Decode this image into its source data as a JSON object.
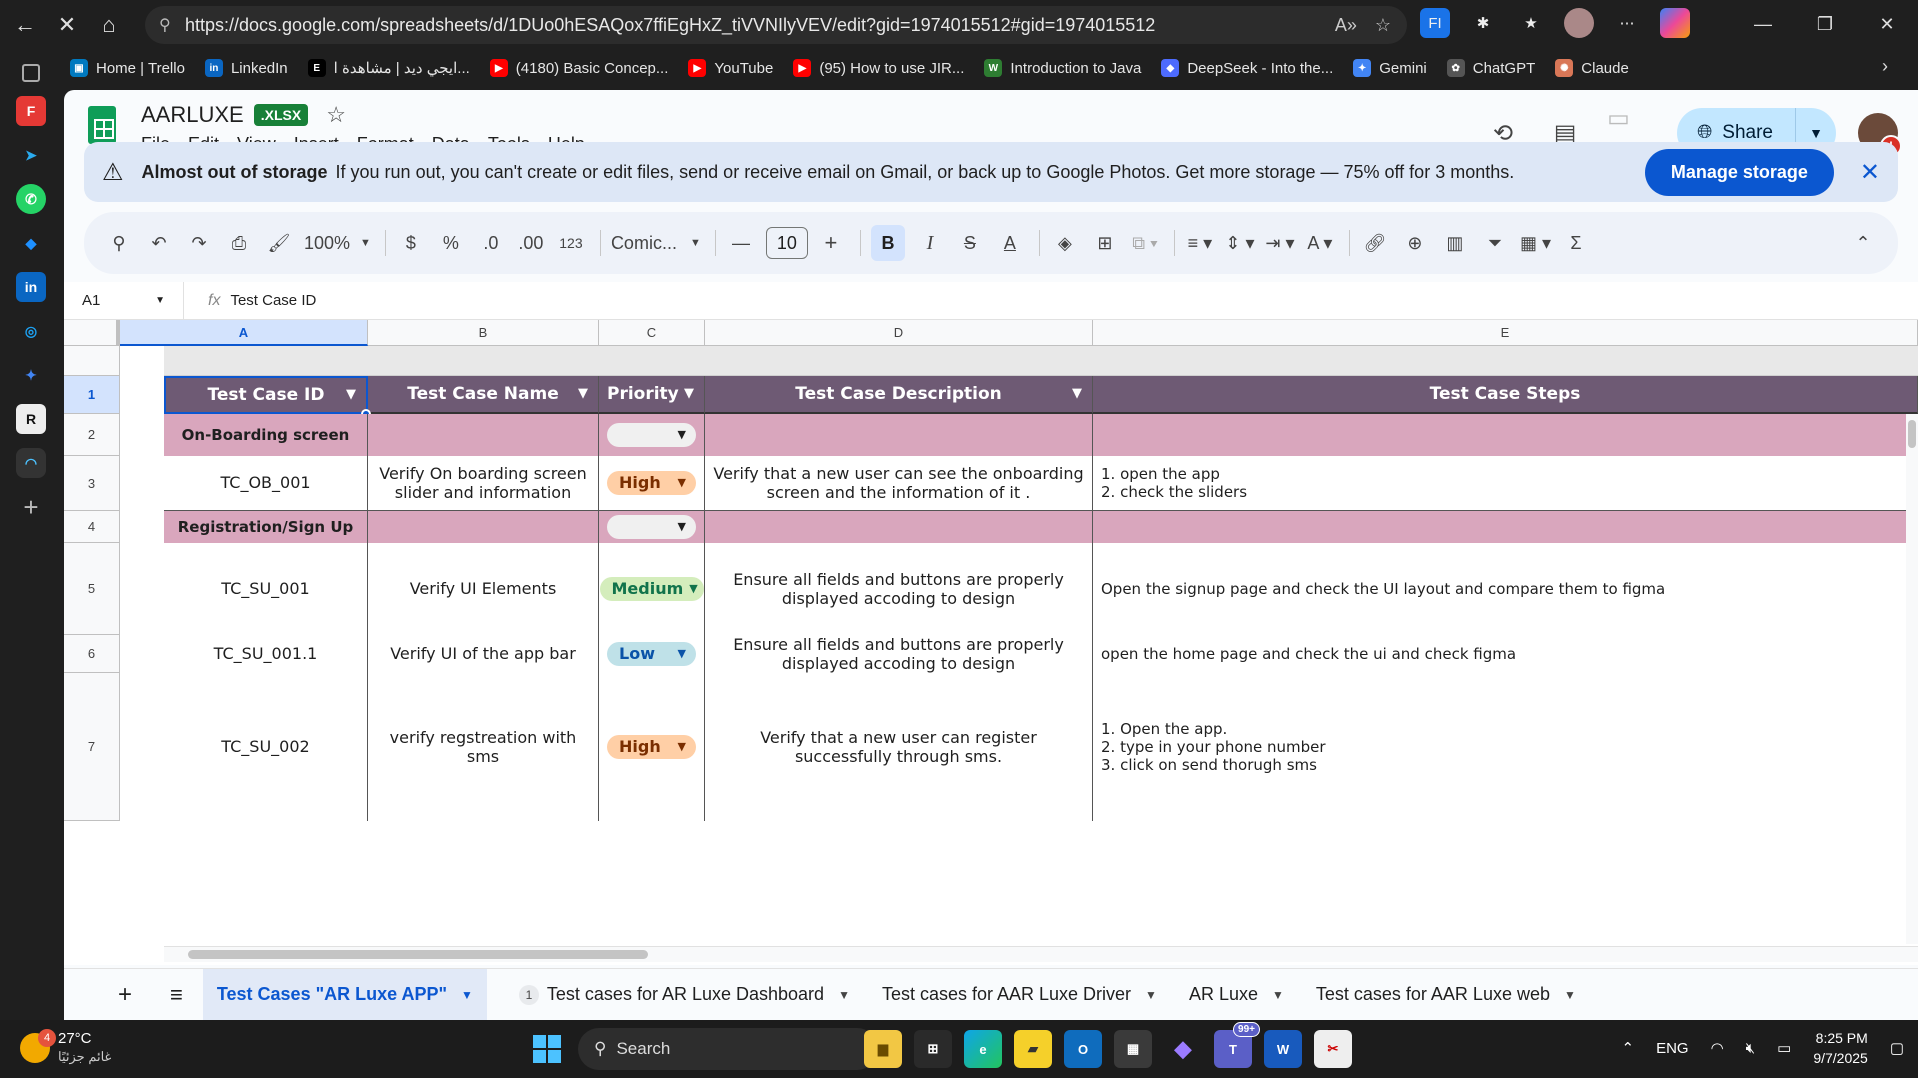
{
  "browser": {
    "url": "https://docs.google.com/spreadsheets/d/1DUo0hESAQox7ffiEgHxZ_tiVVNIlyVEV/edit?gid=1974015512#gid=1974015512",
    "bookmarks": [
      {
        "label": "Home | Trello",
        "color": "#0079bf"
      },
      {
        "label": "LinkedIn",
        "color": "#0a66c2"
      },
      {
        "label": "ايجي ديد | مشاهدة ا...",
        "color": "#000000"
      },
      {
        "label": "(4180) Basic Concep...",
        "color": "#ff0000"
      },
      {
        "label": "YouTube",
        "color": "#ff0000"
      },
      {
        "label": "(95) How to use JIR...",
        "color": "#ff0000"
      },
      {
        "label": "Introduction to Java",
        "color": "#2e7d32"
      },
      {
        "label": "DeepSeek - Into the...",
        "color": "#4d6bfe"
      },
      {
        "label": "Gemini",
        "color": "#4285f4"
      },
      {
        "label": "ChatGPT",
        "color": "#555555"
      },
      {
        "label": "Claude",
        "color": "#d97757"
      }
    ]
  },
  "doc": {
    "title": "AARLUXE",
    "badge": ".XLSX",
    "menu": [
      "File",
      "Edit",
      "View",
      "Insert",
      "Format",
      "Data",
      "Tools",
      "Help"
    ],
    "share_label": "Share"
  },
  "banner": {
    "title": "Almost out of storage",
    "text": "If you run out, you can't create or edit files, send or receive email on Gmail, or back up to Google Photos. Get more storage — 75% off for 3 months.",
    "button": "Manage storage"
  },
  "toolbar": {
    "zoom": "100%",
    "currency": "$",
    "percent": "%",
    "dec_less": ".0",
    "dec_more": ".00",
    "number_format": "123",
    "font": "Comic...",
    "font_size": "10"
  },
  "formula_bar": {
    "cell_ref": "A1",
    "fx": "fx",
    "content": "Test Case ID"
  },
  "columns": [
    "A",
    "B",
    "C",
    "D",
    "E"
  ],
  "headers": {
    "a": "Test Case ID",
    "b": "Test Case Name",
    "c": "Priority",
    "d": "Test Case Description",
    "e": "Test Case Steps"
  },
  "rows": {
    "r2": {
      "num": "2",
      "a": "On-Boarding screen"
    },
    "r3": {
      "num": "3",
      "a": "TC_OB_001",
      "b": "Verify On boarding screen slider and information",
      "priority": "High",
      "d": "Verify that a new user can see the onboarding screen and the information of it .",
      "e": [
        "1. open the app",
        "2. check the sliders"
      ]
    },
    "r4": {
      "num": "4",
      "a": "Registration/Sign Up"
    },
    "r5": {
      "num": "5",
      "a": "TC_SU_001",
      "b": "Verify UI Elements",
      "priority": "Medium",
      "d": "Ensure all fields and buttons are properly displayed accoding to design",
      "e": [
        "Open the signup page and check the UI layout and compare them to figma"
      ]
    },
    "r6": {
      "num": "6",
      "a": "TC_SU_001.1",
      "b": "Verify UI of the app bar",
      "priority": "Low",
      "d": "Ensure all fields and buttons are properly displayed accoding to design",
      "e": [
        "open the home page and check the ui and check figma"
      ]
    },
    "r7": {
      "num": "7",
      "a": "TC_SU_002",
      "b": "verify regstreation with sms",
      "priority": "High",
      "d": "Verify that a new user can register successfully through sms.",
      "e": [
        "1. Open the app.",
        "2. type in your phone number",
        "3. click on send thorugh sms"
      ]
    }
  },
  "header_row_num": "1",
  "priority_colors": {
    "High": "#ffcfa6",
    "Medium": "#d4edbc",
    "Low": "#bfe1e8"
  },
  "sheet_tabs": [
    {
      "label": "Test Cases \"AR Luxe APP\"",
      "active": true
    },
    {
      "label": "Test cases for AR Luxe Dashboard",
      "badge": "1"
    },
    {
      "label": "Test cases for AAR Luxe Driver"
    },
    {
      "label": "AR Luxe"
    },
    {
      "label": "Test cases for AAR Luxe web"
    }
  ],
  "taskbar": {
    "temp": "27°C",
    "weather_text": "غائم جزئيًا",
    "weather_badge": "4",
    "search": "Search",
    "lang": "ENG",
    "time": "8:25 PM",
    "date": "9/7/2025",
    "teams_badge": "99+"
  }
}
